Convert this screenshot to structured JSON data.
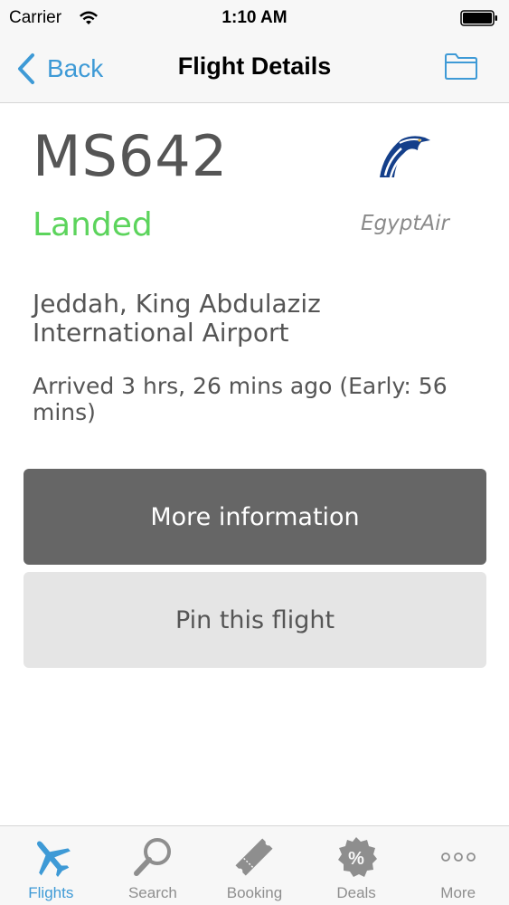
{
  "status_bar": {
    "carrier": "Carrier",
    "time": "1:10 AM"
  },
  "nav": {
    "back_label": "Back",
    "title": "Flight Details",
    "folder_icon": "folder-icon"
  },
  "flight": {
    "number": "MS642",
    "status": "Landed",
    "status_color": "#5cd45c",
    "airline_name": "EgyptAir",
    "airport": "Jeddah, King Abdulaziz International Airport",
    "arrival": "Arrived  3 hrs, 26 mins ago (Early:  56 mins)"
  },
  "buttons": {
    "more_info": "More information",
    "pin": "Pin this flight"
  },
  "tabs": [
    {
      "label": "Flights",
      "icon": "airplane-icon",
      "active": true
    },
    {
      "label": "Search",
      "icon": "magnifier-icon",
      "active": false
    },
    {
      "label": "Booking",
      "icon": "ticket-icon",
      "active": false
    },
    {
      "label": "Deals",
      "icon": "percent-badge-icon",
      "active": false
    },
    {
      "label": "More",
      "icon": "more-dots-icon",
      "active": false
    }
  ],
  "colors": {
    "accent": "#3e9ad6",
    "primary_button": "#666666",
    "secondary_button": "#e5e5e5"
  }
}
